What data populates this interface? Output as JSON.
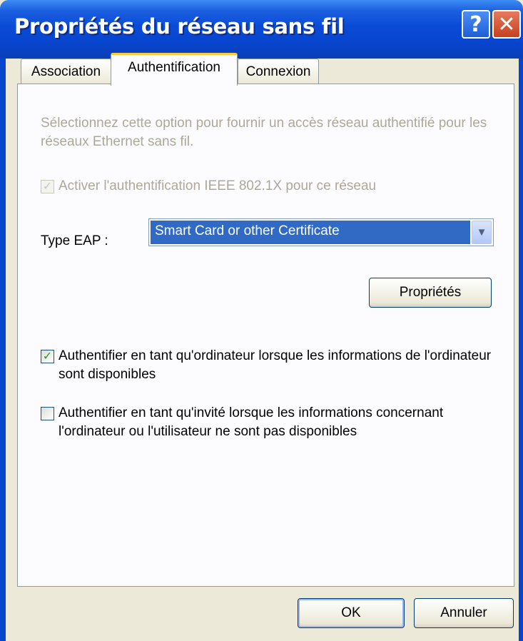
{
  "window": {
    "title": "Propriétés du réseau sans fil",
    "help_glyph": "?",
    "close_glyph": "✕"
  },
  "tabs": [
    {
      "label": "Association",
      "selected": false
    },
    {
      "label": "Authentification",
      "selected": true
    },
    {
      "label": "Connexion",
      "selected": false
    }
  ],
  "auth": {
    "description": "Sélectionnez cette option pour fournir un accès réseau authentifié pour les réseaux Ethernet sans fil.",
    "enable_8021x": {
      "label": "Activer l'authentification IEEE 802.1X pour ce réseau",
      "checked": true,
      "disabled": true
    },
    "eap_type_label": "Type EAP :",
    "eap_type_value": "Smart Card or other Certificate",
    "properties_button": "Propriétés",
    "computer_auth": {
      "label": "Authentifier en tant qu'ordinateur lorsque les informations de l'ordinateur sont disponibles",
      "checked": true
    },
    "guest_auth": {
      "label": "Authentifier en tant qu'invité lorsque les informations concernant l'ordinateur ou l'utilisateur ne sont pas disponibles",
      "checked": false
    }
  },
  "footer": {
    "ok_label": "OK",
    "cancel_label": "Annuler"
  },
  "icons": {
    "check": "✓",
    "dropdown": "▼"
  },
  "colors": {
    "title_bar": "#0845cf",
    "selection": "#316ac5",
    "disabled_text": "#aca899",
    "check_green": "#21a121"
  }
}
